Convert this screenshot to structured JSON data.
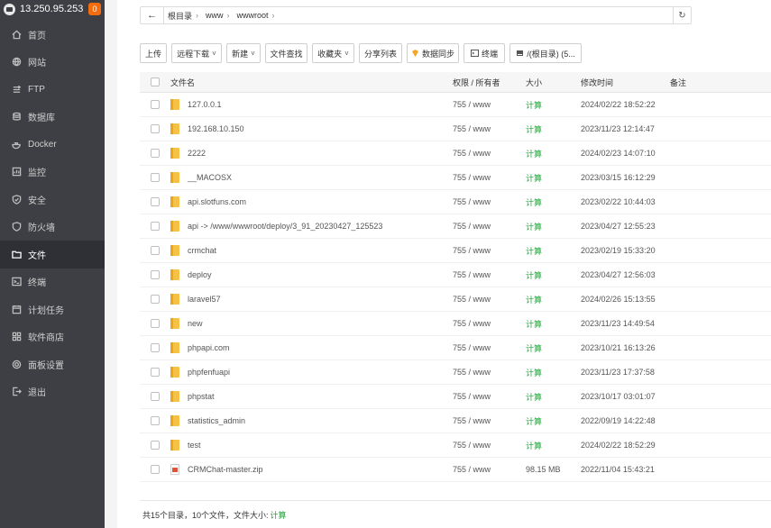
{
  "sidebar": {
    "ip": "13.250.95.253",
    "badge": "0",
    "items": [
      {
        "label": "首页",
        "icon": "home-icon"
      },
      {
        "label": "网站",
        "icon": "globe-icon"
      },
      {
        "label": "FTP",
        "icon": "ftp-icon"
      },
      {
        "label": "数据库",
        "icon": "database-icon"
      },
      {
        "label": "Docker",
        "icon": "docker-icon"
      },
      {
        "label": "监控",
        "icon": "monitor-icon"
      },
      {
        "label": "安全",
        "icon": "shield-icon"
      },
      {
        "label": "防火墙",
        "icon": "firewall-icon"
      },
      {
        "label": "文件",
        "icon": "folder-icon",
        "active": true
      },
      {
        "label": "终端",
        "icon": "terminal-icon"
      },
      {
        "label": "计划任务",
        "icon": "calendar-icon"
      },
      {
        "label": "软件商店",
        "icon": "grid-icon"
      },
      {
        "label": "面板设置",
        "icon": "gear-icon"
      },
      {
        "label": "退出",
        "icon": "logout-icon"
      }
    ]
  },
  "path": {
    "crumbs": [
      "根目录",
      "www",
      "wwwroot"
    ]
  },
  "toolbar": {
    "upload": "上传",
    "remote_download": "远程下载",
    "new": "新建",
    "find": "文件查找",
    "favorites": "收藏夹",
    "share_list": "分享列表",
    "data_sync": "数据同步",
    "terminal": "终端",
    "disk": "/(根目录) (5..."
  },
  "table": {
    "headers": {
      "name": "文件名",
      "perm": "权限 / 所有者",
      "size": "大小",
      "mtime": "修改时间",
      "note": "备注"
    },
    "rows": [
      {
        "type": "folder",
        "name": "127.0.0.1",
        "perm": "755 / www",
        "size": "计算",
        "mtime": "2024/02/22 18:52:22"
      },
      {
        "type": "folder",
        "name": "192.168.10.150",
        "perm": "755 / www",
        "size": "计算",
        "mtime": "2023/11/23 12:14:47"
      },
      {
        "type": "folder",
        "name": "2222",
        "perm": "755 / www",
        "size": "计算",
        "mtime": "2024/02/23 14:07:10"
      },
      {
        "type": "folder",
        "name": "__MACOSX",
        "perm": "755 / www",
        "size": "计算",
        "mtime": "2023/03/15 16:12:29"
      },
      {
        "type": "folder",
        "name": "api.slotfuns.com",
        "perm": "755 / www",
        "size": "计算",
        "mtime": "2023/02/22 10:44:03"
      },
      {
        "type": "folder",
        "name": "api -> /www/wwwroot/deploy/3_91_20230427_125523",
        "perm": "755 / www",
        "size": "计算",
        "mtime": "2023/04/27 12:55:23"
      },
      {
        "type": "folder",
        "name": "crmchat",
        "perm": "755 / www",
        "size": "计算",
        "mtime": "2023/02/19 15:33:20"
      },
      {
        "type": "folder",
        "name": "deploy",
        "perm": "755 / www",
        "size": "计算",
        "mtime": "2023/04/27 12:56:03"
      },
      {
        "type": "folder",
        "name": "laravel57",
        "perm": "755 / www",
        "size": "计算",
        "mtime": "2024/02/26 15:13:55"
      },
      {
        "type": "folder",
        "name": "new",
        "perm": "755 / www",
        "size": "计算",
        "mtime": "2023/11/23 14:49:54"
      },
      {
        "type": "folder",
        "name": "phpapi.com",
        "perm": "755 / www",
        "size": "计算",
        "mtime": "2023/10/21 16:13:26"
      },
      {
        "type": "folder",
        "name": "phpfenfuapi",
        "perm": "755 / www",
        "size": "计算",
        "mtime": "2023/11/23 17:37:58"
      },
      {
        "type": "folder",
        "name": "phpstat",
        "perm": "755 / www",
        "size": "计算",
        "mtime": "2023/10/17 03:01:07"
      },
      {
        "type": "folder",
        "name": "statistics_admin",
        "perm": "755 / www",
        "size": "计算",
        "mtime": "2022/09/19 14:22:48"
      },
      {
        "type": "folder",
        "name": "test",
        "perm": "755 / www",
        "size": "计算",
        "mtime": "2024/02/22 18:52:29"
      },
      {
        "type": "zip",
        "name": "CRMChat-master.zip",
        "perm": "755 / www",
        "size": "98.15 MB",
        "mtime": "2022/11/04 15:43:21"
      }
    ]
  },
  "footer": {
    "summary": "共15个目录，10个文件，文件大小:",
    "calc": "计算"
  },
  "colors": {
    "sidebar_bg": "#3d3f44",
    "accent_green": "#20a53a",
    "badge": "#f56c0f",
    "folder": "#f6c245"
  }
}
